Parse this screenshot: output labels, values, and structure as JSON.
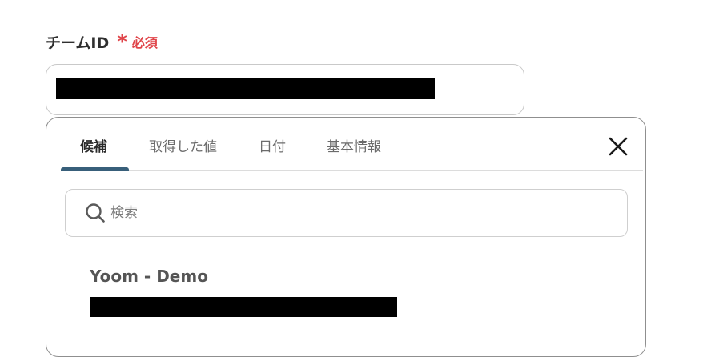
{
  "field": {
    "label": "チームID",
    "required_mark": "*",
    "required_text": "必須"
  },
  "popover": {
    "tabs": [
      {
        "label": "候補"
      },
      {
        "label": "取得した値"
      },
      {
        "label": "日付"
      },
      {
        "label": "基本情報"
      }
    ],
    "active_tab": "候補",
    "close_icon": "close-icon",
    "search": {
      "placeholder": "検索",
      "value": "",
      "icon": "search-icon"
    },
    "options": [
      {
        "title": "Yoom - Demo"
      }
    ]
  },
  "colors": {
    "required": "#e0454a",
    "tab_indicator": "#385f7a",
    "border": "#c9c9c9"
  }
}
